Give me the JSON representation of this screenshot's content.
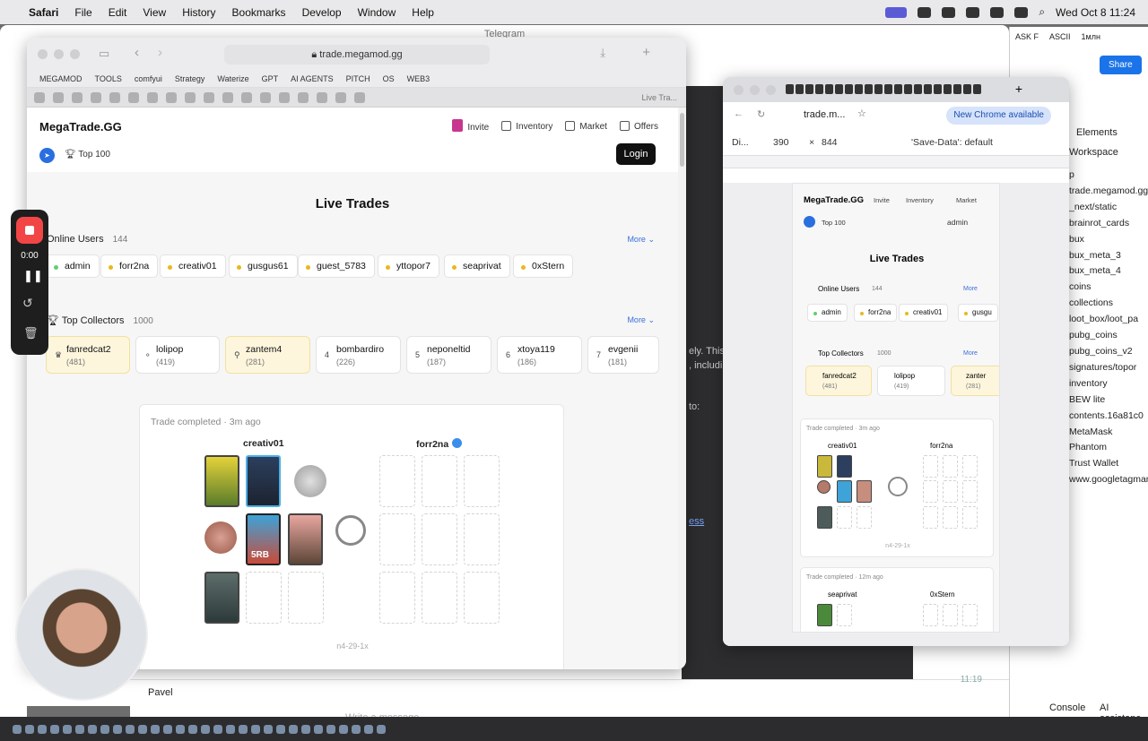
{
  "menubar": {
    "app": "Safari",
    "items": [
      "File",
      "Edit",
      "View",
      "History",
      "Bookmarks",
      "Develop",
      "Window",
      "Help"
    ],
    "clock": "Wed Oct 8  11:24"
  },
  "telegram": {
    "title": "Telegram",
    "compose_placeholder": "Write a message...",
    "sender": "Pavel",
    "time": "11:19",
    "side_text": [
      "ely. This",
      ", includi",
      "to:",
      "ess"
    ]
  },
  "devtools": {
    "tabs": {
      "elements": "Elements",
      "console": "Console",
      "ai": "AI assistanc"
    },
    "top": [
      "ASK F",
      "ASCII",
      "1млн",
      "Share"
    ],
    "workspace": "Workspace",
    "tree": [
      "p",
      "trade.megamod.gg",
      "_next/static",
      "brainrot_cards",
      "bux",
      "bux_meta_3",
      "bux_meta_4",
      "coins",
      "collections",
      "loot_box/loot_pa",
      "pubg_coins",
      "pubg_coins_v2",
      "signatures/topor",
      "inventory",
      "BEW lite",
      "contents.16a81c0",
      "MetaMask",
      "Phantom",
      "Trust Wallet",
      "www.googletagman"
    ]
  },
  "safari": {
    "url": "trade.megamod.gg",
    "bookmarks": [
      "MEGAMOD",
      "TOOLS",
      "comfyui",
      "Strategy",
      "Waterize",
      "GPT",
      "AI AGENTS",
      "PITCH",
      "OS",
      "WEB3"
    ],
    "active_tab": "Live Tra..."
  },
  "site": {
    "brand": "MegaTrade.GG",
    "nav": [
      "Invite",
      "Inventory",
      "Market",
      "Offers"
    ],
    "top100": "Top 100",
    "login": "Login",
    "title": "Live Trades",
    "online_label": "Online Users",
    "online_count": "144",
    "more": "More",
    "users": [
      "admin",
      "forr2na",
      "creativ01",
      "gusgus61",
      "guest_5783",
      "yttopor7",
      "seaprivat",
      "0xStern"
    ],
    "collectors_label": "Top Collectors",
    "collectors_count": "1000",
    "collectors": [
      {
        "rank": "",
        "name": "fanredcat2",
        "count": "(481)"
      },
      {
        "rank": "",
        "name": "lolipop",
        "count": "(419)"
      },
      {
        "rank": "",
        "name": "zantem4",
        "count": "(281)"
      },
      {
        "rank": "4",
        "name": "bombardiro",
        "count": "(226)"
      },
      {
        "rank": "5",
        "name": "neponeltid",
        "count": "(187)"
      },
      {
        "rank": "6",
        "name": "xtoya119",
        "count": "(186)"
      },
      {
        "rank": "7",
        "name": "evgenii",
        "count": "(181)"
      }
    ],
    "trade": {
      "status": "Trade completed",
      "time": "3m ago",
      "from": "creativ01",
      "to": "forr2na",
      "id": "n4-29-1x",
      "card_label": "5RB"
    }
  },
  "chrome": {
    "url": "trade.m...",
    "update": "New Chrome available",
    "device": "Di...",
    "width": "390",
    "height": "844",
    "save_data": "'Save-Data': default",
    "mobile": {
      "user": "admin",
      "users": [
        "admin",
        "forr2na",
        "creativ01",
        "gusgu"
      ],
      "collectors": [
        {
          "name": "fanredcat2",
          "count": "(481)"
        },
        {
          "name": "lolipop",
          "count": "(419)"
        },
        {
          "name": "zanter",
          "count": "(281)"
        }
      ],
      "trade2": {
        "status": "Trade completed",
        "time": "12m ago",
        "from": "seaprivat",
        "to": "0xStern"
      }
    }
  },
  "recorder": {
    "time": "0:00"
  },
  "colors": {
    "accent": "#3a6fd8",
    "gold": "#fdf6dc",
    "online": "#5fcf72",
    "away": "#e8b91b"
  }
}
